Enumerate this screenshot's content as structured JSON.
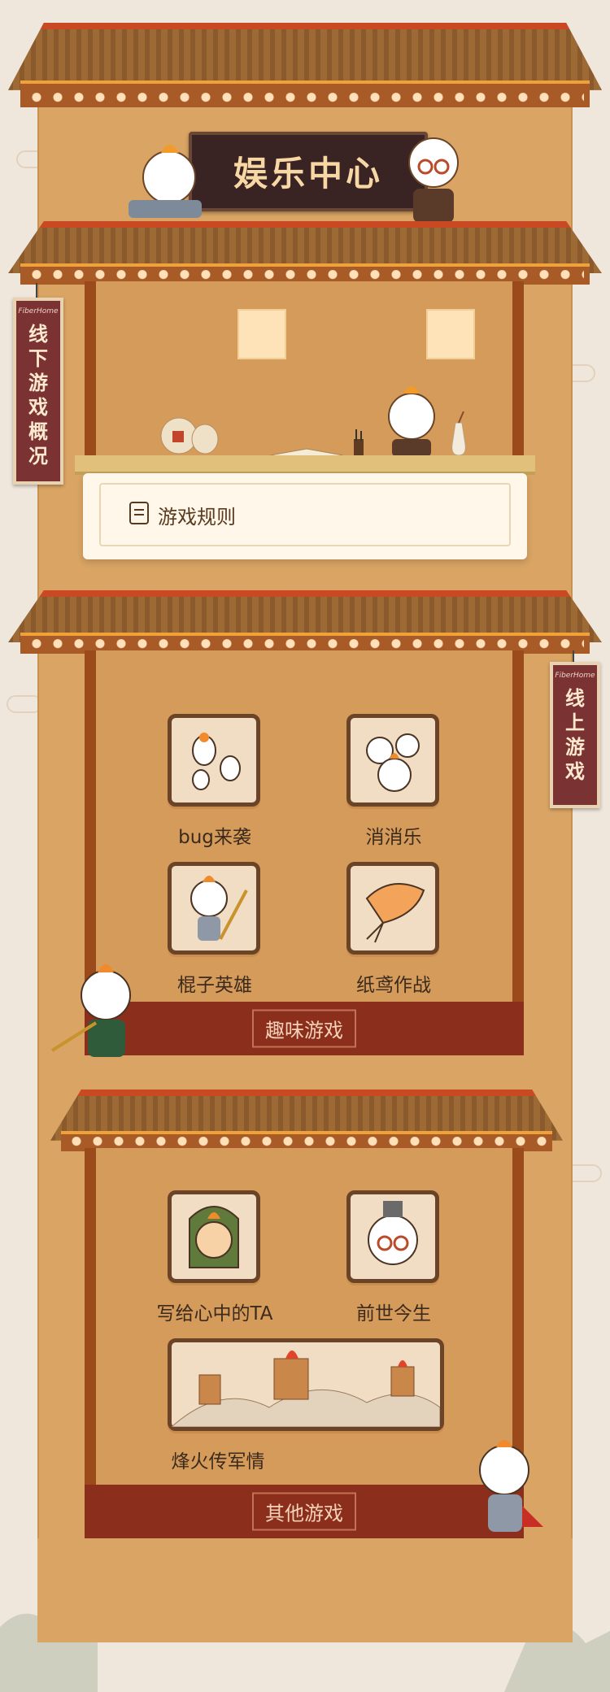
{
  "header": {
    "title": "娱乐中心"
  },
  "offline_banner": {
    "logo": "FiberHome",
    "text": "线下游戏概况"
  },
  "online_banner": {
    "logo": "FiberHome",
    "text": "线上游戏"
  },
  "rules": {
    "label": "游戏规则"
  },
  "fun_games": {
    "section_label": "趣味游戏",
    "items": [
      {
        "label": "bug来袭",
        "icon": "beetle-icon"
      },
      {
        "label": "消消乐",
        "icon": "match-faces-icon"
      },
      {
        "label": "棍子英雄",
        "icon": "stick-hero-icon"
      },
      {
        "label": "纸鸢作战",
        "icon": "kite-icon"
      }
    ]
  },
  "other_games": {
    "section_label": "其他游戏",
    "items": [
      {
        "label": "写给心中的TA",
        "icon": "general-face-icon"
      },
      {
        "label": "前世今生",
        "icon": "scholar-face-icon"
      },
      {
        "label": "烽火传军情",
        "icon": "great-wall-icon"
      }
    ]
  },
  "colors": {
    "background": "#efe7dc",
    "tower": "#d9a464",
    "roof_trim": "#c94a22",
    "banner": "#7a3232",
    "footer_band": "#8b2e1c"
  }
}
